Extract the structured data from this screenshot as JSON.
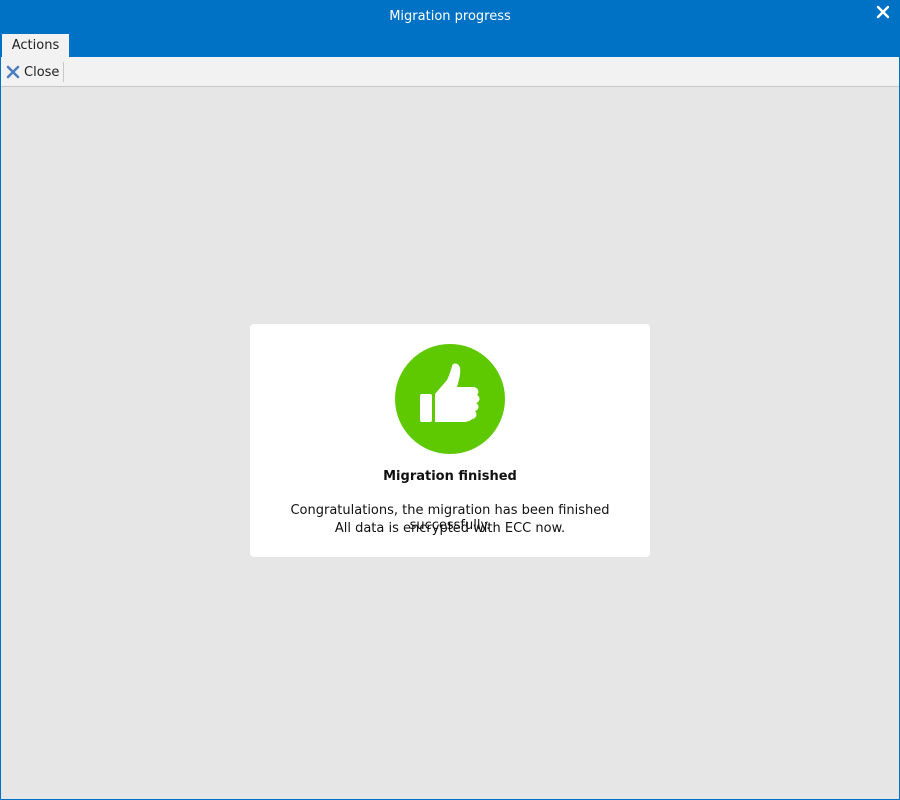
{
  "window": {
    "title": "Migration progress"
  },
  "tabs": [
    {
      "label": "Actions"
    }
  ],
  "ribbon": {
    "close_label": "Close"
  },
  "dialog": {
    "title": "Migration finished",
    "message_line1": "Congratulations, the migration has been finished successfully.",
    "message_line2": "All data is encrypted with ECC now.",
    "icon": "thumbs-up-icon"
  },
  "colors": {
    "titlebar": "#0072c6",
    "success": "#5ec800",
    "background": "#e6e6e6"
  }
}
